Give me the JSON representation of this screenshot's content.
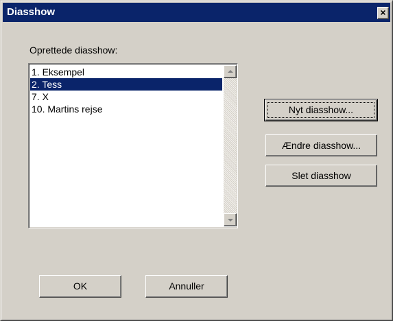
{
  "window": {
    "title": "Diasshow",
    "close_label": "×"
  },
  "list": {
    "label": "Oprettede diasshow:",
    "items": [
      {
        "label": "1. Eksempel",
        "selected": false
      },
      {
        "label": "2. Tess",
        "selected": true
      },
      {
        "label": "7. X",
        "selected": false
      },
      {
        "label": "10. Martins rejse",
        "selected": false
      }
    ],
    "scrollbar": {
      "up_icon": "arrow-up",
      "down_icon": "arrow-down"
    }
  },
  "actions": {
    "new_label": "Nyt diasshow...",
    "edit_label": "Ændre diasshow...",
    "delete_label": "Slet diasshow"
  },
  "footer": {
    "ok_label": "OK",
    "cancel_label": "Annuller"
  },
  "colors": {
    "titlebar": "#0a246a",
    "dialog_face": "#d4d0c8",
    "selection": "#0a246a"
  }
}
